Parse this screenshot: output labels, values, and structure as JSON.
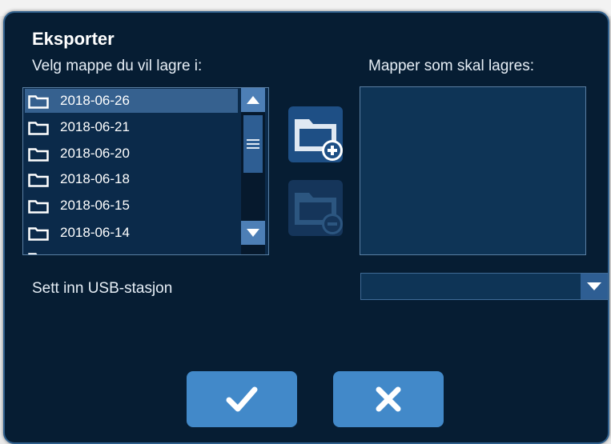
{
  "dialog": {
    "title": "Eksporter",
    "source_label": "Velg mappe du vil lagre i:",
    "destination_label": "Mapper som skal lagres:",
    "usb_label": "Sett inn USB-stasjon"
  },
  "folders": {
    "selected_index": 0,
    "items": [
      {
        "label": "2018-06-26"
      },
      {
        "label": "2018-06-21"
      },
      {
        "label": "2018-06-20"
      },
      {
        "label": "2018-06-18"
      },
      {
        "label": "2018-06-15"
      },
      {
        "label": "2018-06-14"
      }
    ]
  },
  "destination": {
    "items": []
  },
  "usb_select": {
    "value": ""
  },
  "icons": {
    "folder": "folder-icon",
    "scroll_up": "triangle-up-icon",
    "scroll_down": "triangle-down-icon",
    "scroll_thumb": "grip-lines-icon",
    "add_folder": "folder-add-icon",
    "remove_folder": "folder-remove-icon",
    "dropdown": "chevron-down-icon",
    "confirm": "checkmark-icon",
    "cancel": "close-icon"
  },
  "colors": {
    "dialog_background": "#061d33",
    "accent_button": "#4289c9",
    "selection": "#36618f"
  }
}
